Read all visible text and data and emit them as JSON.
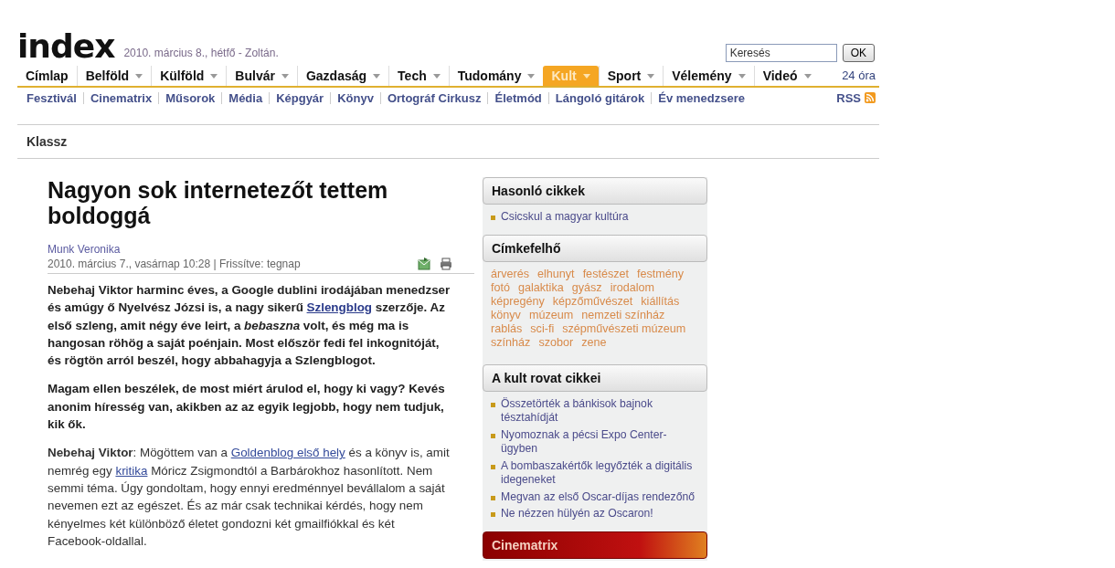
{
  "header": {
    "logo": "index",
    "date": "2010. március  8., hétfő - Zoltán.",
    "search": {
      "value": "Keresés",
      "button": "OK"
    }
  },
  "nav": {
    "items": [
      {
        "label": "Címlap",
        "has_menu": false,
        "selected": false
      },
      {
        "label": "Belföld",
        "has_menu": true,
        "selected": false
      },
      {
        "label": "Külföld",
        "has_menu": true,
        "selected": false
      },
      {
        "label": "Bulvár",
        "has_menu": true,
        "selected": false
      },
      {
        "label": "Gazdaság",
        "has_menu": true,
        "selected": false
      },
      {
        "label": "Tech",
        "has_menu": true,
        "selected": false
      },
      {
        "label": "Tudomány",
        "has_menu": true,
        "selected": false
      },
      {
        "label": "Kult",
        "has_menu": true,
        "selected": true
      },
      {
        "label": "Sport",
        "has_menu": true,
        "selected": false
      },
      {
        "label": "Vélemény",
        "has_menu": true,
        "selected": false
      },
      {
        "label": "Videó",
        "has_menu": true,
        "selected": false
      }
    ],
    "right_link": "24 óra"
  },
  "subnav": {
    "items": [
      "Fesztivál",
      "Cinematrix",
      "Műsorok",
      "Média",
      "Képgyár",
      "Könyv",
      "Ortográf Cirkusz",
      "Életmód",
      "Lángoló gitárok",
      "Év menedzsere"
    ],
    "rss": "RSS"
  },
  "section_title": "Klassz",
  "article": {
    "title": "Nagyon sok internetezőt tettem boldoggá",
    "author": "Munk Veronika",
    "date": "2010. március 7., vasárnap 10:28 | Frissítve: tegnap",
    "paragraphs": [
      {
        "bold": true,
        "parts": [
          {
            "kind": "text",
            "text": "Nebehaj Viktor harminc éves, a Google dublini irodájában menedzser és amúgy ő Nyelvész Józsi is, a nagy sikerű "
          },
          {
            "kind": "link",
            "text": "Szlengblog"
          },
          {
            "kind": "text",
            "text": " szerzője. Az első szleng, amit négy éve leirt, a *bebaszna* volt, és még ma is hangosan röhög a saját poénjain. Most először fedi fel inkognitóját, és rögtön arról beszél, hogy abbahagyja a Szlengblogot."
          }
        ]
      },
      {
        "bold": true,
        "parts": [
          {
            "kind": "text",
            "text": "Magam ellen beszélek, de most miért árulod el, hogy ki vagy? Kevés anonim híresség van, akikben az az egyik legjobb, hogy nem tudjuk, kik ők."
          }
        ]
      },
      {
        "bold": false,
        "parts": [
          {
            "kind": "text",
            "text": "**Nebehaj Viktor**: Mögöttem van a "
          },
          {
            "kind": "link",
            "text": "Goldenblog első hely"
          },
          {
            "kind": "text",
            "text": " és a könyv is, amit nemrég egy "
          },
          {
            "kind": "link",
            "text": "kritika"
          },
          {
            "kind": "text",
            "text": " Móricz Zsigmondtól a Barbárokhoz hasonlított. Nem semmi téma. Úgy gondoltam, hogy ennyi eredménnyel bevállalom a saját nevemen ezt az egészet. És az már csak technikai kérdés, hogy nem kényelmes két különböző életet gondozni két gmailfiókkal és két Facebook-oldallal."
          }
        ]
      }
    ]
  },
  "sidebar": {
    "boxes": [
      {
        "kind": "list",
        "title": "Hasonló cikkek",
        "items": [
          "Csicskul a magyar kultúra"
        ]
      },
      {
        "kind": "tags",
        "title": "Címkefelhő",
        "items": [
          "árverés",
          "elhunyt",
          "festészet",
          "festmény",
          "fotó",
          "galaktika",
          "gyász",
          "irodalom",
          "képregény",
          "képzőművészet",
          "kiállítás",
          "könyv",
          "múzeum",
          "nemzeti színház",
          "rablás",
          "sci-fi",
          "szépművészeti múzeum",
          "színház",
          "szobor",
          "zene"
        ]
      },
      {
        "kind": "list",
        "title": "A kult rovat cikkei",
        "items": [
          "Összetörték a bánkisok bajnok tésztahídját",
          "Nyomoznak a pécsi Expo Center-ügyben",
          "A bombaszakértők legyőzték a digitális idegeneket",
          "Megvan az első Oscar-díjas rendezőnő",
          "Ne nézzen hülyén az Oscaron!"
        ]
      },
      {
        "kind": "banner",
        "title": "Cinematrix"
      }
    ]
  }
}
